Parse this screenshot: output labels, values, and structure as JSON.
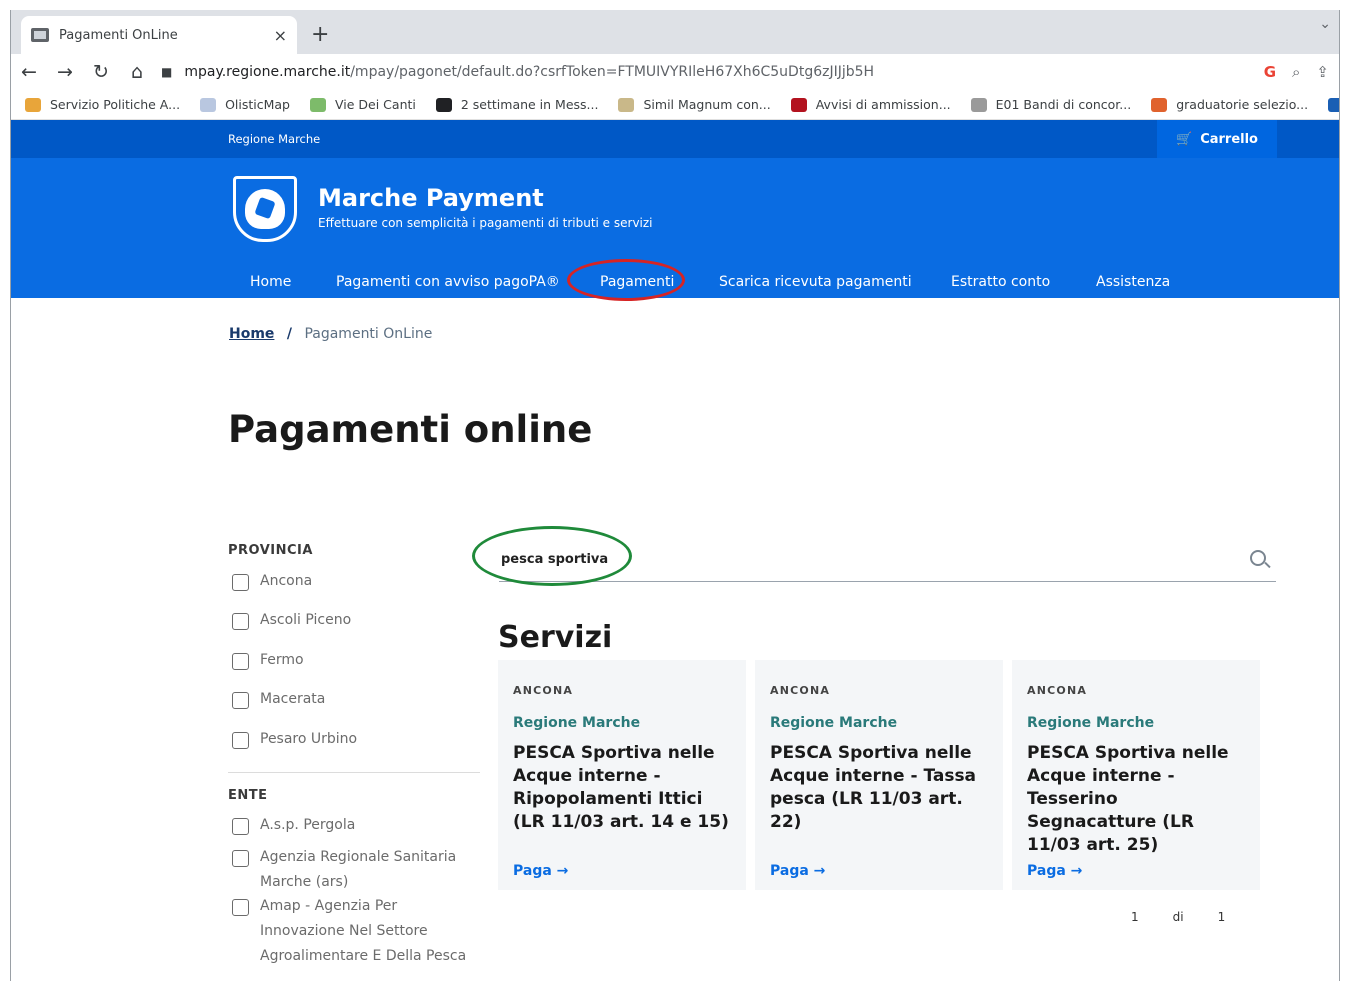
{
  "browser": {
    "tab_title": "Pagamenti OnLine",
    "tab_close": "×",
    "new_tab": "+",
    "tab_menu": "⌄",
    "nav": {
      "back": "←",
      "forward": "→",
      "reload": "↻",
      "home": "⌂"
    },
    "url_host": "mpay.regione.marche.it",
    "url_path": "/mpay/pagonet/default.do?csrfToken=FTMUIVYRIleH67Xh6C5uDtg6zJIJjb5H",
    "tb_icons": {
      "google": "G",
      "zoom": "⌕",
      "share": "⇪"
    },
    "bookmarks": [
      {
        "label": "Servizio Politiche A...",
        "color": "#e8a53a"
      },
      {
        "label": "OlisticMap",
        "color": "#b9c7e0"
      },
      {
        "label": "Vie Dei Canti",
        "color": "#7dbb6a"
      },
      {
        "label": "2 settimane in Mess...",
        "color": "#202124"
      },
      {
        "label": "Simil Magnum con...",
        "color": "#c9b889"
      },
      {
        "label": "Avvisi di ammission...",
        "color": "#b3121f"
      },
      {
        "label": "E01 Bandi di concor...",
        "color": "#9a9a9a"
      },
      {
        "label": "graduatorie selezio...",
        "color": "#e0622d"
      },
      {
        "label": "",
        "color": "#1a5fb4"
      }
    ]
  },
  "site": {
    "region_label": "Regione Marche",
    "cart_label": "Carrello",
    "cart_icon": "🛒",
    "brand_name": "Marche Payment",
    "brand_sub": "Effettuare con semplicità i pagamenti di tributi e servizi",
    "nav": [
      "Home",
      "Pagamenti con avviso pagoPA®",
      "Pagamenti",
      "Scarica ricevuta pagamenti",
      "Estratto conto",
      "Assistenza"
    ]
  },
  "breadcrumb": {
    "home": "Home",
    "sep": "/",
    "current": "Pagamenti OnLine"
  },
  "page_title": "Pagamenti online",
  "filters": {
    "provincia_heading": "PROVINCIA",
    "province": [
      "Ancona",
      "Ascoli Piceno",
      "Fermo",
      "Macerata",
      "Pesaro Urbino"
    ],
    "ente_heading": "ENTE",
    "enti": [
      "A.s.p. Pergola",
      "Agenzia Regionale Sanitaria Marche (ars)",
      "Amap - Agenzia Per Innovazione Nel Settore Agroalimentare E Della Pesca"
    ]
  },
  "search": {
    "query": "pesca sportiva"
  },
  "results": {
    "heading": "Servizi",
    "cards": [
      {
        "provincia": "ANCONA",
        "ente": "Regione Marche",
        "title": "PESCA Sportiva nelle Acque interne - Ripopolamenti Ittici (LR 11/03 art. 14 e 15)",
        "action": "Paga →"
      },
      {
        "provincia": "ANCONA",
        "ente": "Regione Marche",
        "title": "PESCA Sportiva nelle Acque interne - Tassa pesca (LR 11/03 art. 22)",
        "action": "Paga →"
      },
      {
        "provincia": "ANCONA",
        "ente": "Regione Marche",
        "title": "PESCA Sportiva nelle Acque interne - Tesserino Segnacatture (LR 11/03 art. 25)",
        "action": "Paga →"
      }
    ],
    "pager": {
      "current": "1",
      "of": "di",
      "total": "1"
    }
  },
  "colors": {
    "header_dark": "#0058c6",
    "header": "#0a6ce2",
    "annotation_red": "#d62424",
    "annotation_green": "#1f8a3a",
    "ente_teal": "#2a7a7a"
  }
}
